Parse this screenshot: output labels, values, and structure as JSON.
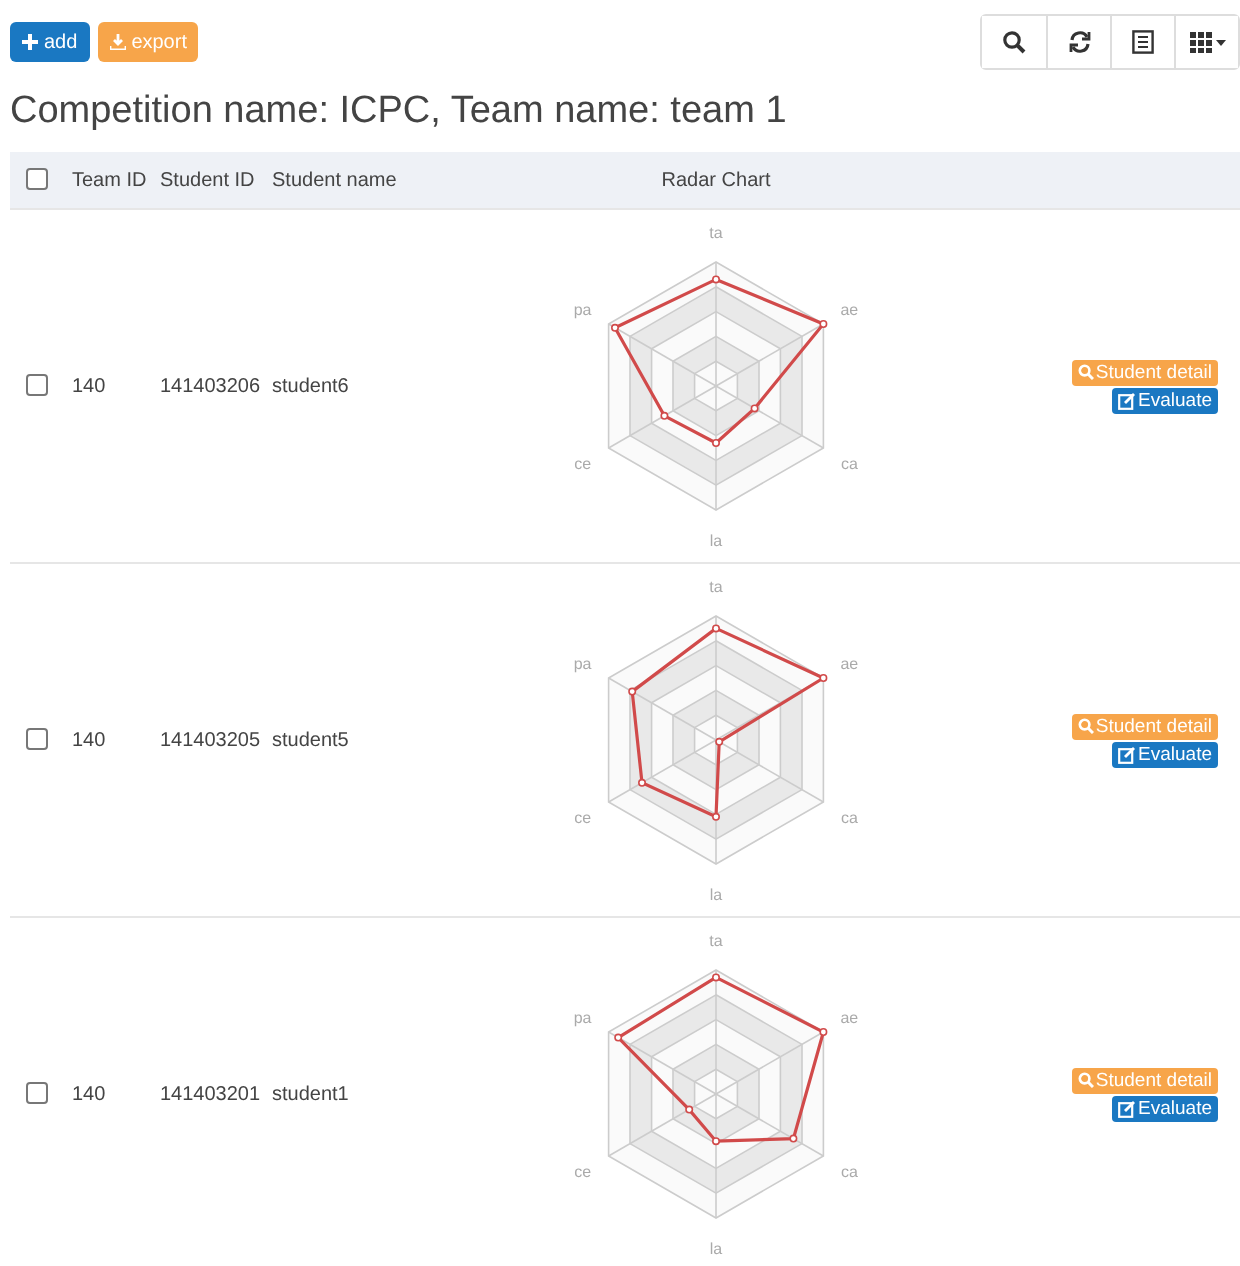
{
  "toolbar": {
    "buttons": [
      {
        "kind": "add",
        "label": "add"
      },
      {
        "kind": "export",
        "label": "export"
      }
    ],
    "tools": [
      {
        "kind": "search"
      },
      {
        "kind": "refresh"
      },
      {
        "kind": "list"
      },
      {
        "kind": "columns"
      }
    ]
  },
  "heading": "Competition name: ICPC, Team name: team 1",
  "table": {
    "header_checked": false,
    "columns": [
      "Team ID",
      "Student ID",
      "Student name",
      "Radar Chart"
    ],
    "rows": [
      {
        "checked": false,
        "team_id": "140",
        "student_id": "141403206",
        "student_name": "student6",
        "radar_axes": [
          "ta",
          "ae",
          "ca",
          "la",
          "ce",
          "pa"
        ],
        "actions": [
          "Student detail",
          "Evaluate"
        ]
      },
      {
        "checked": false,
        "team_id": "140",
        "student_id": "141403205",
        "student_name": "student5",
        "radar_axes": [
          "ta",
          "ae",
          "ca",
          "la",
          "ce",
          "pa"
        ],
        "actions": [
          "Student detail",
          "Evaluate"
        ]
      },
      {
        "checked": false,
        "team_id": "140",
        "student_id": "141403201",
        "student_name": "student1",
        "radar_axes": [
          "ta",
          "ae",
          "ca",
          "la",
          "ce",
          "pa"
        ],
        "actions": [
          "Student detail",
          "Evaluate"
        ]
      }
    ]
  }
}
